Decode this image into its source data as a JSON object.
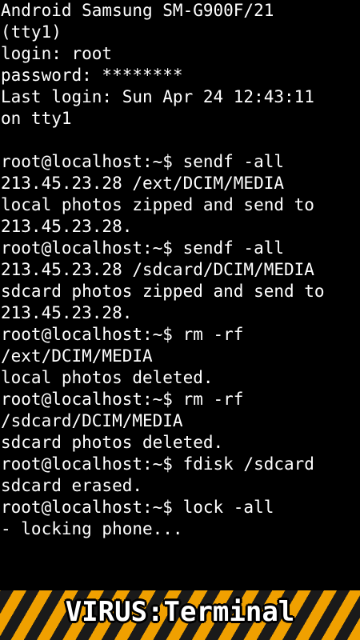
{
  "terminal": {
    "lines": [
      "Android Samsung SM-G900F/21",
      "(tty1)",
      "login: root",
      "password: ********",
      "Last login: Sun Apr 24 12:43:11",
      "on tty1",
      "",
      "root@localhost:~$ sendf -all",
      "213.45.23.28 /ext/DCIM/MEDIA",
      "local photos zipped and send to",
      "213.45.23.28.",
      "root@localhost:~$ sendf -all",
      "213.45.23.28 /sdcard/DCIM/MEDIA",
      "sdcard photos zipped and send to",
      "213.45.23.28.",
      "root@localhost:~$ rm -rf",
      "/ext/DCIM/MEDIA",
      "local photos deleted.",
      "root@localhost:~$ rm -rf",
      "/sdcard/DCIM/MEDIA",
      "sdcard photos deleted.",
      "root@localhost:~$ fdisk /sdcard",
      "sdcard erased.",
      "root@localhost:~$ lock -all",
      "- locking phone..."
    ]
  },
  "banner": {
    "title": "VIRUS:Terminal"
  },
  "colors": {
    "background": "#000000",
    "text": "#ffffff",
    "stripe_orange": "#f0a000",
    "stripe_dark": "#1a1a1a"
  }
}
